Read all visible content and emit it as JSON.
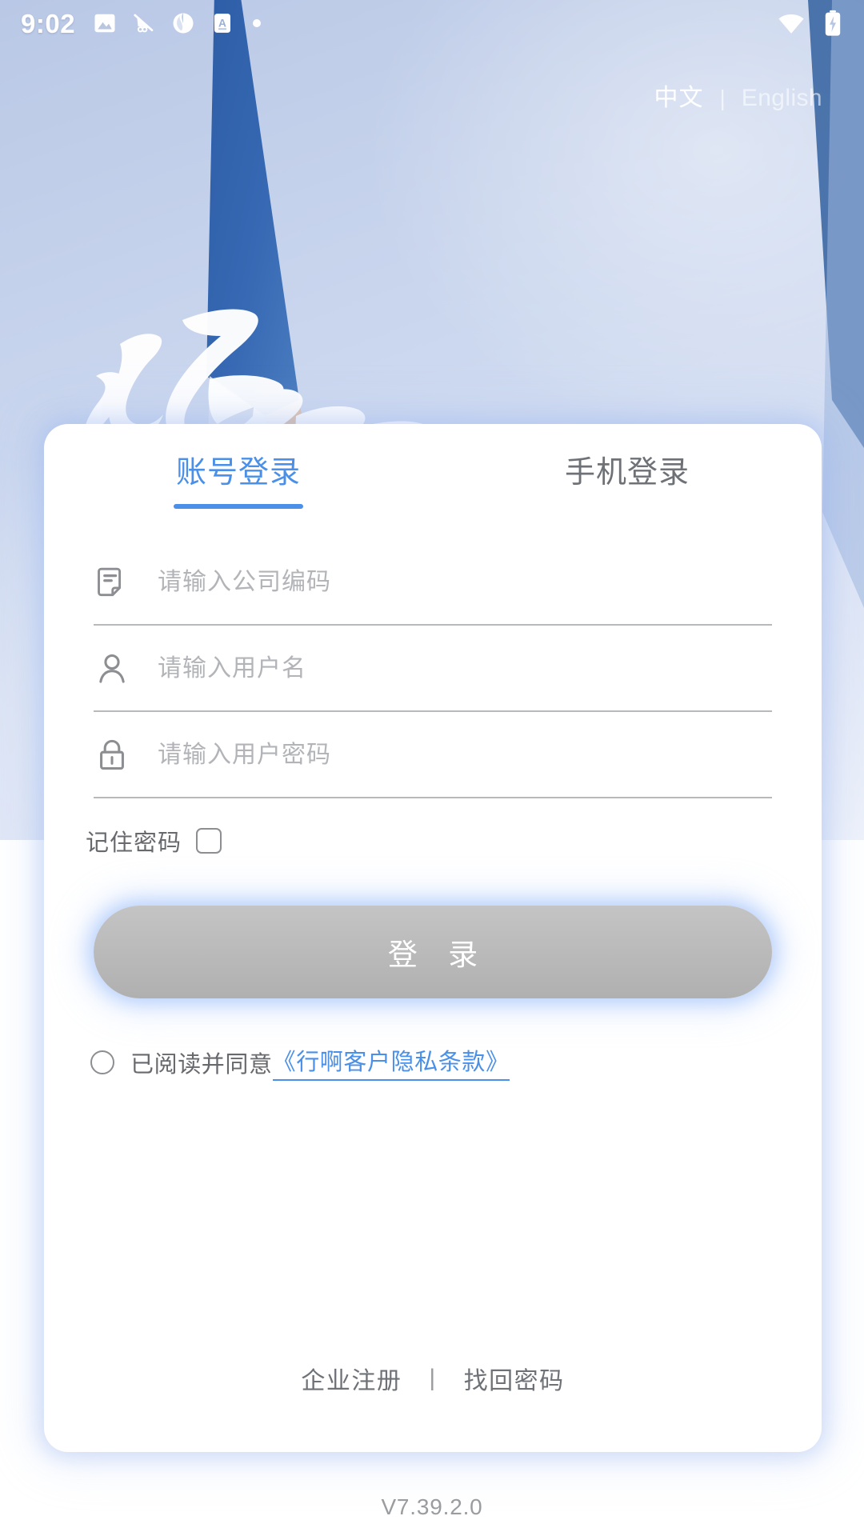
{
  "status_bar": {
    "time": "9:02",
    "left_icons": [
      "image-icon",
      "notification-slash-icon",
      "app-circle-icon",
      "letter-a-icon",
      "dot-icon"
    ],
    "right_icons": [
      "wifi-icon",
      "battery-charging-icon"
    ]
  },
  "language": {
    "chinese": "中文",
    "separator": "|",
    "english": "English",
    "selected": "中文"
  },
  "tabs": [
    {
      "label": "账号登录",
      "active": true
    },
    {
      "label": "手机登录",
      "active": false
    }
  ],
  "fields": [
    {
      "icon": "company-code-icon",
      "placeholder": "请输入公司编码",
      "value": ""
    },
    {
      "icon": "user-icon",
      "placeholder": "请输入用户名",
      "value": ""
    },
    {
      "icon": "lock-icon",
      "placeholder": "请输入用户密码",
      "value": ""
    }
  ],
  "remember": {
    "label": "记住密码",
    "checked": false
  },
  "login": {
    "label": "登 录",
    "enabled": false
  },
  "agreement": {
    "checked": false,
    "text": "已阅读并同意",
    "link": "《行啊客户隐私条款》"
  },
  "footer": {
    "register": "企业注册",
    "separator": "|",
    "forgot": "找回密码"
  },
  "version": "V7.39.2.0",
  "colors": {
    "accent": "#4a90e8",
    "placeholder": "#b2b4b8",
    "text_muted": "#6e7277",
    "rule": "#b8b9bb",
    "button_disabled": "#bababa",
    "card_bg": "#ffffff",
    "winglet_blue": "#2f62ab",
    "sky": "#c3d0ea"
  }
}
